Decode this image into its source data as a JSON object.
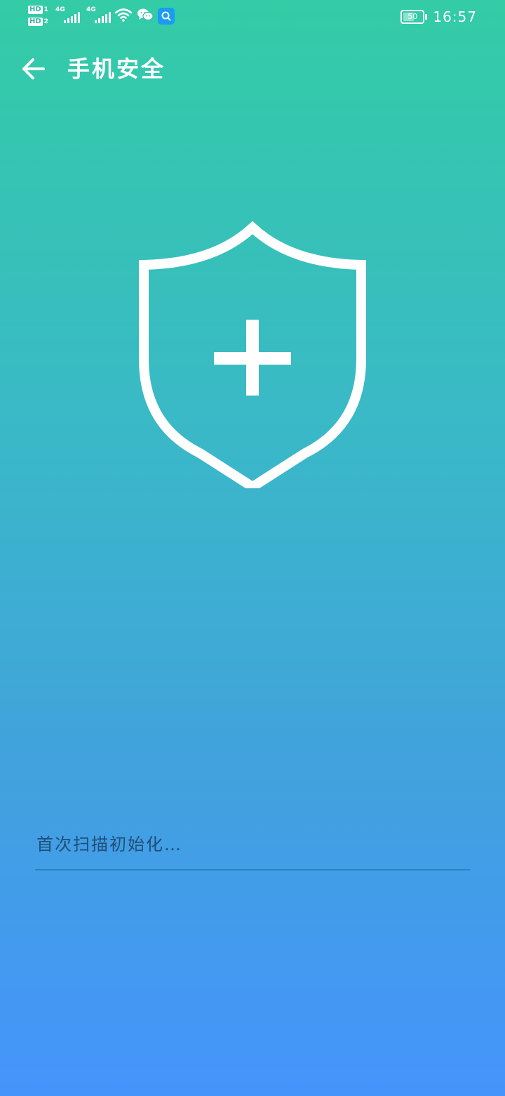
{
  "status_bar": {
    "sim1_badge": "HD",
    "sim1_number": "1",
    "sim2_badge": "HD",
    "sim2_number": "2",
    "network1": "4G",
    "network2": "4G",
    "battery_level": "50",
    "time": "16:57",
    "icons": [
      "signal-icon",
      "signal-icon",
      "wifi-icon",
      "wechat-icon",
      "search-app-icon",
      "battery-icon"
    ]
  },
  "app_bar": {
    "title": "手机安全",
    "back_icon": "arrow-left-icon"
  },
  "hero": {
    "icon": "shield-plus-icon"
  },
  "scan": {
    "status_text": "首次扫描初始化…",
    "progress": 0
  },
  "colors": {
    "gradient_top": "#33cca6",
    "gradient_bottom": "#4594fc",
    "status_text": "#1f4e79",
    "icon": "#ffffff"
  }
}
